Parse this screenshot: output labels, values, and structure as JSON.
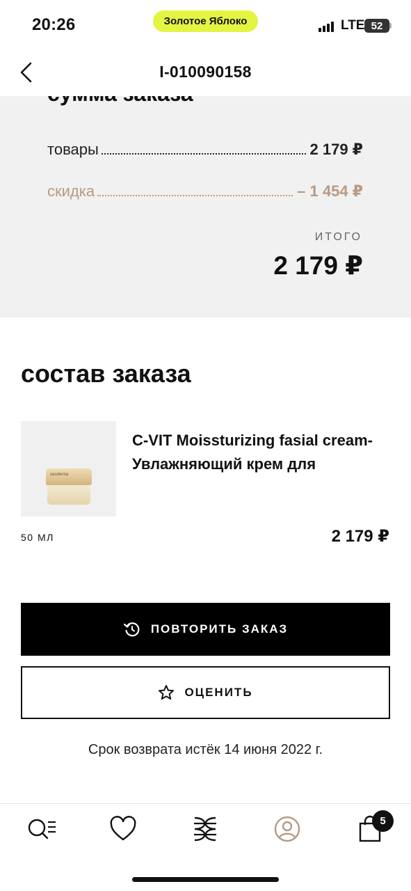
{
  "status_bar": {
    "time": "20:26",
    "carrier": "Золотое Яблоко",
    "network": "LTE",
    "battery": "52"
  },
  "header": {
    "order_number": "I-010090158"
  },
  "summary": {
    "title": "сумма заказа",
    "goods_label": "товары",
    "goods_amount": "2 179 ₽",
    "discount_label": "скидка",
    "discount_amount": "– 1 454 ₽",
    "total_label": "ИТОГО",
    "total_amount": "2 179 ₽"
  },
  "composition": {
    "title": "состав заказа",
    "items": [
      {
        "name": "C-VIT Moissturizing fasial cream-Увлажняющий крем для",
        "volume": "50 МЛ",
        "price": "2 179 ₽",
        "brand": "sesderma"
      }
    ]
  },
  "actions": {
    "repeat_label": "ПОВТОРИТЬ ЗАКАЗ",
    "rate_label": "ОЦЕНИТЬ"
  },
  "return_note": "Срок возврата истёк 14 июня 2022 г.",
  "tab_bar": {
    "items": [
      "search-catalog-icon",
      "heart-icon",
      "brand-logo-icon",
      "profile-icon",
      "shopping-bag-icon"
    ],
    "active_color": "#b89a82",
    "cart_count": "5"
  },
  "colors": {
    "accent_pill": "#e3f542",
    "discount": "#b89a82",
    "summary_bg": "#f1f1f1"
  }
}
